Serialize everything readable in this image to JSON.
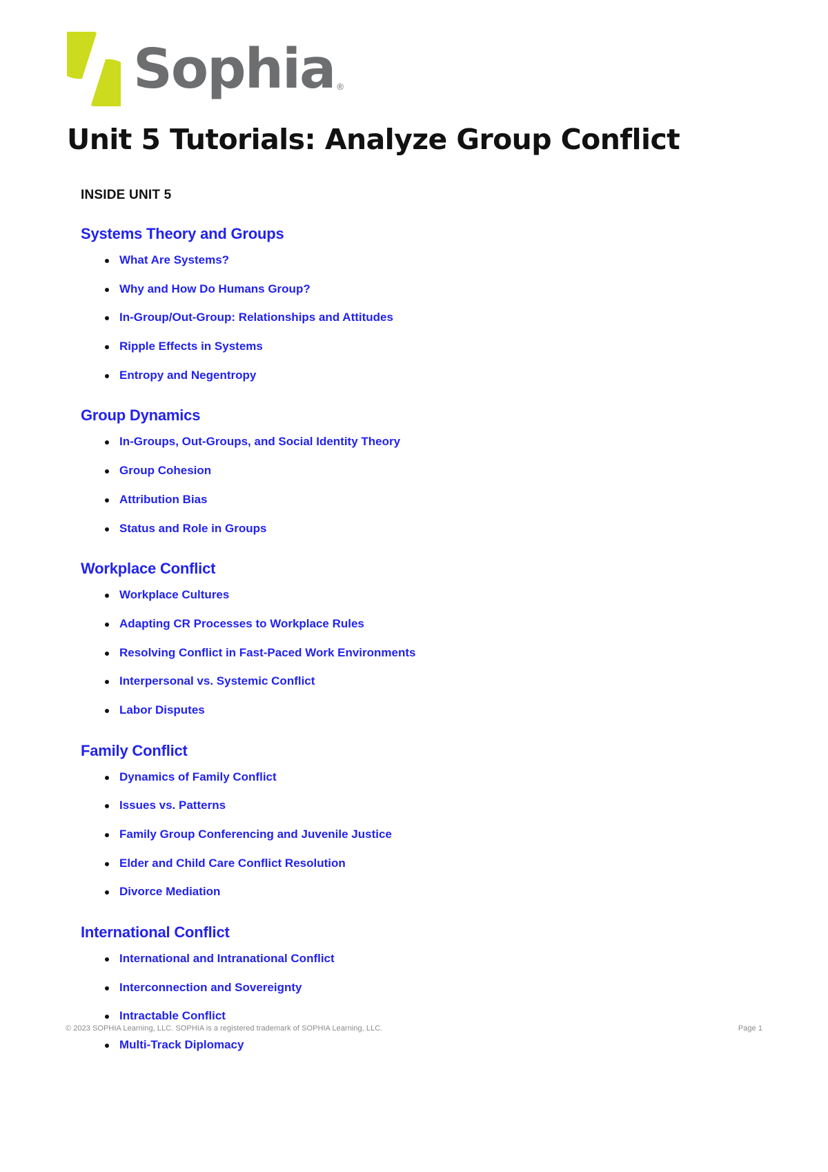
{
  "brand": {
    "logo_text": "Sophia",
    "logo_registered_mark": "®",
    "logo_mark_color": "#ccdb1d",
    "logo_text_color": "#6d6e70"
  },
  "document": {
    "title": "Unit 5 Tutorials: Analyze Group Conflict",
    "inside_heading": "INSIDE UNIT 5",
    "link_color": "#2222ee",
    "text_color": "#111111"
  },
  "sections": [
    {
      "heading": "Systems Theory and Groups",
      "items": [
        "What Are Systems?",
        "Why and How Do Humans Group?",
        "In-Group/Out-Group: Relationships and Attitudes",
        "Ripple Effects in Systems",
        "Entropy and Negentropy"
      ]
    },
    {
      "heading": "Group Dynamics",
      "items": [
        "In-Groups, Out-Groups, and Social Identity Theory",
        "Group Cohesion",
        "Attribution Bias",
        "Status and Role in Groups"
      ]
    },
    {
      "heading": "Workplace Conflict",
      "items": [
        "Workplace Cultures",
        "Adapting CR Processes to Workplace Rules",
        "Resolving Conflict in Fast-Paced Work Environments",
        "Interpersonal vs. Systemic Conflict",
        "Labor Disputes"
      ]
    },
    {
      "heading": "Family Conflict",
      "items": [
        "Dynamics of Family Conflict",
        "Issues vs. Patterns",
        "Family Group Conferencing and Juvenile Justice",
        "Elder and Child Care Conflict Resolution",
        "Divorce Mediation"
      ]
    },
    {
      "heading": "International Conflict",
      "items": [
        "International and Intranational Conflict",
        "Interconnection and Sovereignty",
        "Intractable Conflict",
        "Multi-Track Diplomacy"
      ]
    }
  ],
  "footer": {
    "copyright": "© 2023 SOPHIA Learning, LLC. SOPHIA is a registered trademark of SOPHIA Learning, LLC.",
    "page_label": "Page 1"
  }
}
